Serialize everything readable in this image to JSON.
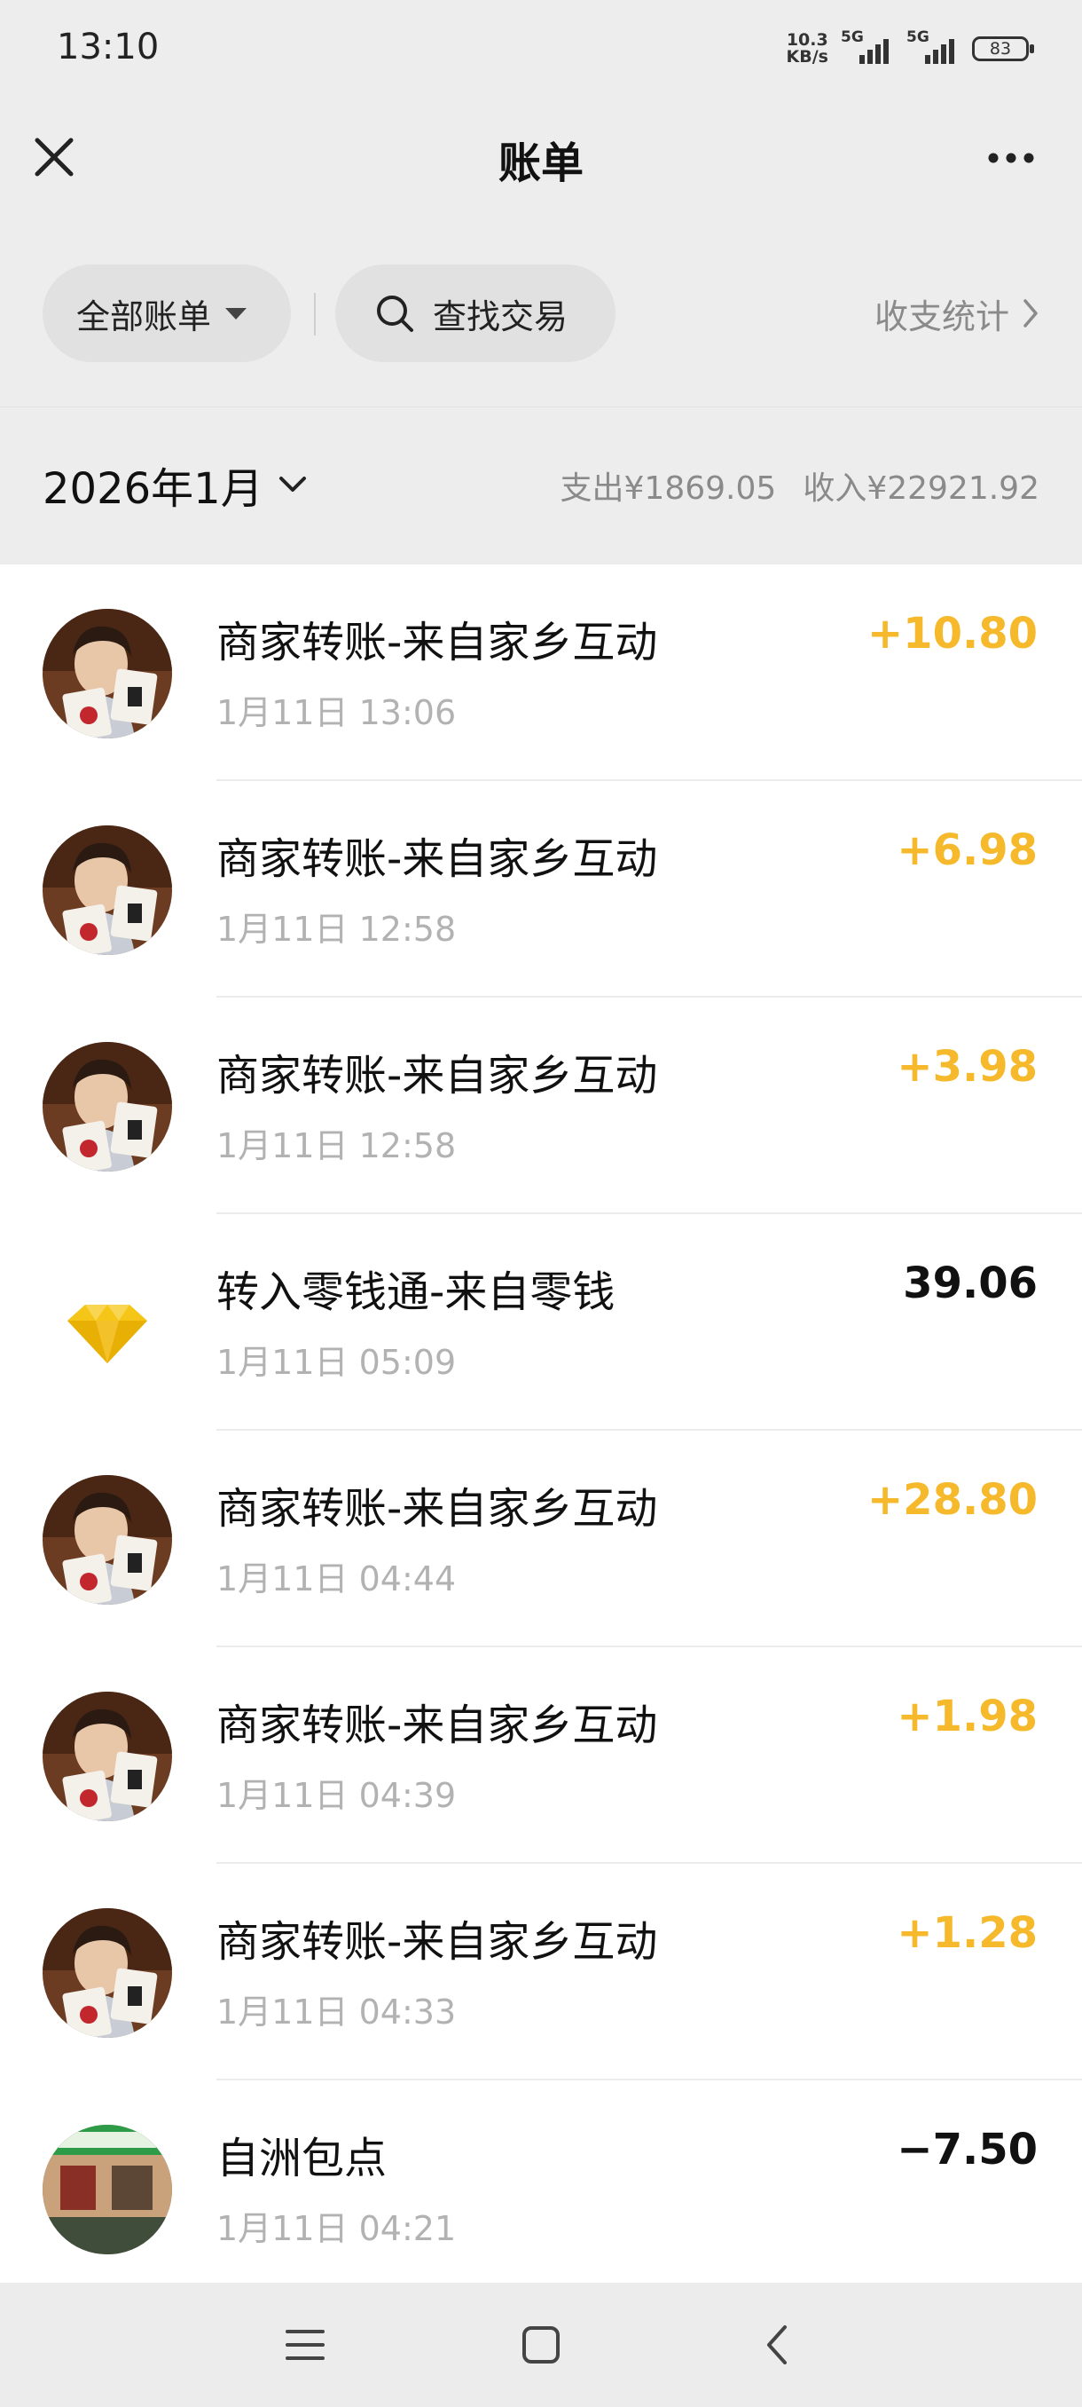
{
  "status_bar": {
    "time": "13:10",
    "net_speed_value": "10.3",
    "net_speed_unit": "KB/s",
    "signal1_label": "5G",
    "signal2_label": "5G",
    "battery": "83"
  },
  "nav": {
    "title": "账单",
    "close_icon": "close-icon",
    "more_icon": "more-horizontal-icon"
  },
  "filters": {
    "all_bills_label": "全部账单",
    "search_label": "查找交易",
    "stats_label": "收支统计"
  },
  "month_bar": {
    "month": "2026年1月",
    "expense": "支出¥1869.05",
    "income": "收入¥22921.92"
  },
  "transactions": [
    {
      "title": "商家转账-来自家乡互动",
      "time": "1月11日 13:06",
      "amount": "+10.80",
      "type": "income",
      "avatar": "game-character-avatar"
    },
    {
      "title": "商家转账-来自家乡互动",
      "time": "1月11日 12:58",
      "amount": "+6.98",
      "type": "income",
      "avatar": "game-character-avatar"
    },
    {
      "title": "商家转账-来自家乡互动",
      "time": "1月11日 12:58",
      "amount": "+3.98",
      "type": "income",
      "avatar": "game-character-avatar"
    },
    {
      "title": "转入零钱通-来自零钱",
      "time": "1月11日 05:09",
      "amount": "39.06",
      "type": "neutral",
      "avatar": "diamond-icon"
    },
    {
      "title": "商家转账-来自家乡互动",
      "time": "1月11日 04:44",
      "amount": "+28.80",
      "type": "income",
      "avatar": "game-character-avatar"
    },
    {
      "title": "商家转账-来自家乡互动",
      "time": "1月11日 04:39",
      "amount": "+1.98",
      "type": "income",
      "avatar": "game-character-avatar"
    },
    {
      "title": "商家转账-来自家乡互动",
      "time": "1月11日 04:33",
      "amount": "+1.28",
      "type": "income",
      "avatar": "game-character-avatar"
    },
    {
      "title": "自洲包点",
      "time": "1月11日 04:21",
      "amount": "−7.50",
      "type": "neutral",
      "avatar": "shop-storefront-avatar"
    }
  ],
  "colors": {
    "income": "#f5b92b",
    "neutral": "#111111",
    "secondary_text": "#b2b2b2",
    "page_background": "#ededed"
  },
  "system_nav": {
    "menu_icon": "menu-icon",
    "home_icon": "home-square-icon",
    "back_icon": "back-chevron-icon"
  }
}
